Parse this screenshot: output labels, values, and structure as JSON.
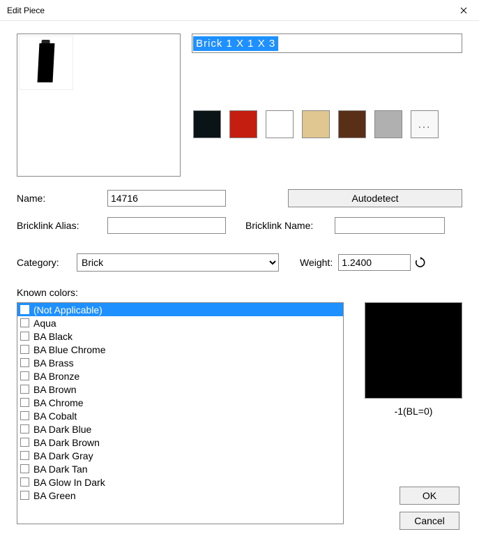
{
  "window": {
    "title": "Edit Piece"
  },
  "description": "Brick 1 X 1 X 3",
  "swatches": [
    {
      "name": "black",
      "hex": "#0a1416"
    },
    {
      "name": "red",
      "hex": "#c41e10"
    },
    {
      "name": "white",
      "hex": "#ffffff"
    },
    {
      "name": "tan",
      "hex": "#e0c690"
    },
    {
      "name": "brown",
      "hex": "#5a2f17"
    },
    {
      "name": "gray",
      "hex": "#b0b0b0"
    }
  ],
  "more_label": "...",
  "labels": {
    "name": "Name:",
    "autodetect": "Autodetect",
    "bricklink_alias": "Bricklink Alias:",
    "bricklink_name": "Bricklink Name:",
    "category": "Category:",
    "weight": "Weight:",
    "known_colors": "Known colors:",
    "ok": "OK",
    "cancel": "Cancel"
  },
  "fields": {
    "name": "14716",
    "bricklink_alias": "",
    "bricklink_name": "",
    "category": "Brick",
    "weight": "1.2400"
  },
  "known_colors": [
    {
      "label": "(Not Applicable)",
      "selected": true
    },
    {
      "label": "Aqua"
    },
    {
      "label": "BA Black"
    },
    {
      "label": "BA Blue Chrome"
    },
    {
      "label": "BA Brass"
    },
    {
      "label": "BA Bronze"
    },
    {
      "label": "BA Brown"
    },
    {
      "label": "BA Chrome"
    },
    {
      "label": "BA Cobalt"
    },
    {
      "label": "BA Dark Blue"
    },
    {
      "label": "BA Dark Brown"
    },
    {
      "label": "BA Dark Gray"
    },
    {
      "label": "BA Dark Tan"
    },
    {
      "label": "BA Glow In Dark"
    },
    {
      "label": "BA Green"
    }
  ],
  "color_preview": {
    "hex": "#000000",
    "code": "-1(BL=0)"
  }
}
